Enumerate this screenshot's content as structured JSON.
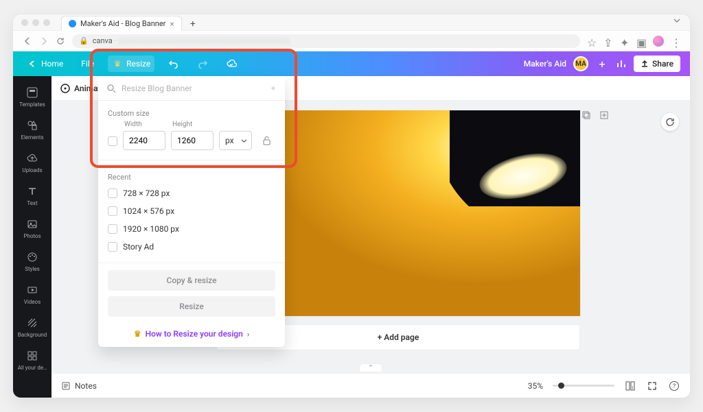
{
  "browser": {
    "tab_title": "Maker's Aid - Blog Banner",
    "url_host": "canva"
  },
  "canva_top": {
    "home": "Home",
    "file": "File",
    "resize": "Resize",
    "brand": "Maker's Aid",
    "badge_initials": "MA",
    "share": "Share"
  },
  "sidebar": {
    "items": [
      {
        "label": "Templates"
      },
      {
        "label": "Elements"
      },
      {
        "label": "Uploads"
      },
      {
        "label": "Text"
      },
      {
        "label": "Photos"
      },
      {
        "label": "Styles"
      },
      {
        "label": "Videos"
      },
      {
        "label": "Background"
      },
      {
        "label": "All your de…"
      }
    ]
  },
  "toolbar": {
    "animate": "Animate"
  },
  "resize_panel": {
    "search_placeholder": "Resize Blog Banner",
    "custom_size_label": "Custom size",
    "width_label": "Width",
    "height_label": "Height",
    "width_value": "2240",
    "height_value": "1260",
    "unit": "px",
    "recent_label": "Recent",
    "recent": [
      {
        "label": "728 × 728 px"
      },
      {
        "label": "1024 × 576 px"
      },
      {
        "label": "1920 × 1080 px"
      },
      {
        "label": "Story Ad"
      }
    ],
    "copy_resize": "Copy & resize",
    "resize_btn": "Resize",
    "howto": "How to Resize your design"
  },
  "canvas": {
    "add_page": "+ Add page"
  },
  "bottombar": {
    "notes": "Notes",
    "zoom": "35%"
  }
}
